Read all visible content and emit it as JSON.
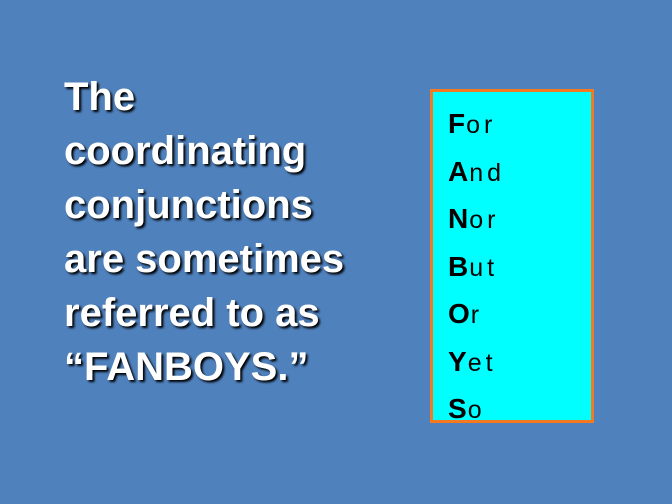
{
  "slide": {
    "main_text_lines": [
      "The",
      "coordinating",
      "conjunctions",
      "are sometimes",
      "referred to as",
      "“FANBOYS.”"
    ],
    "fanboys": [
      {
        "letter": "F",
        "rest": "or"
      },
      {
        "letter": "A",
        "rest": "nd"
      },
      {
        "letter": "N",
        "rest": "or"
      },
      {
        "letter": "B",
        "rest": "ut"
      },
      {
        "letter": "O",
        "rest": "r"
      },
      {
        "letter": "Y",
        "rest": "et"
      },
      {
        "letter": "S",
        "rest": "o"
      }
    ],
    "colors": {
      "background": "#4f81bd",
      "box_fill": "#00ffff",
      "box_border": "#f47920",
      "main_text": "#ffffff"
    }
  }
}
